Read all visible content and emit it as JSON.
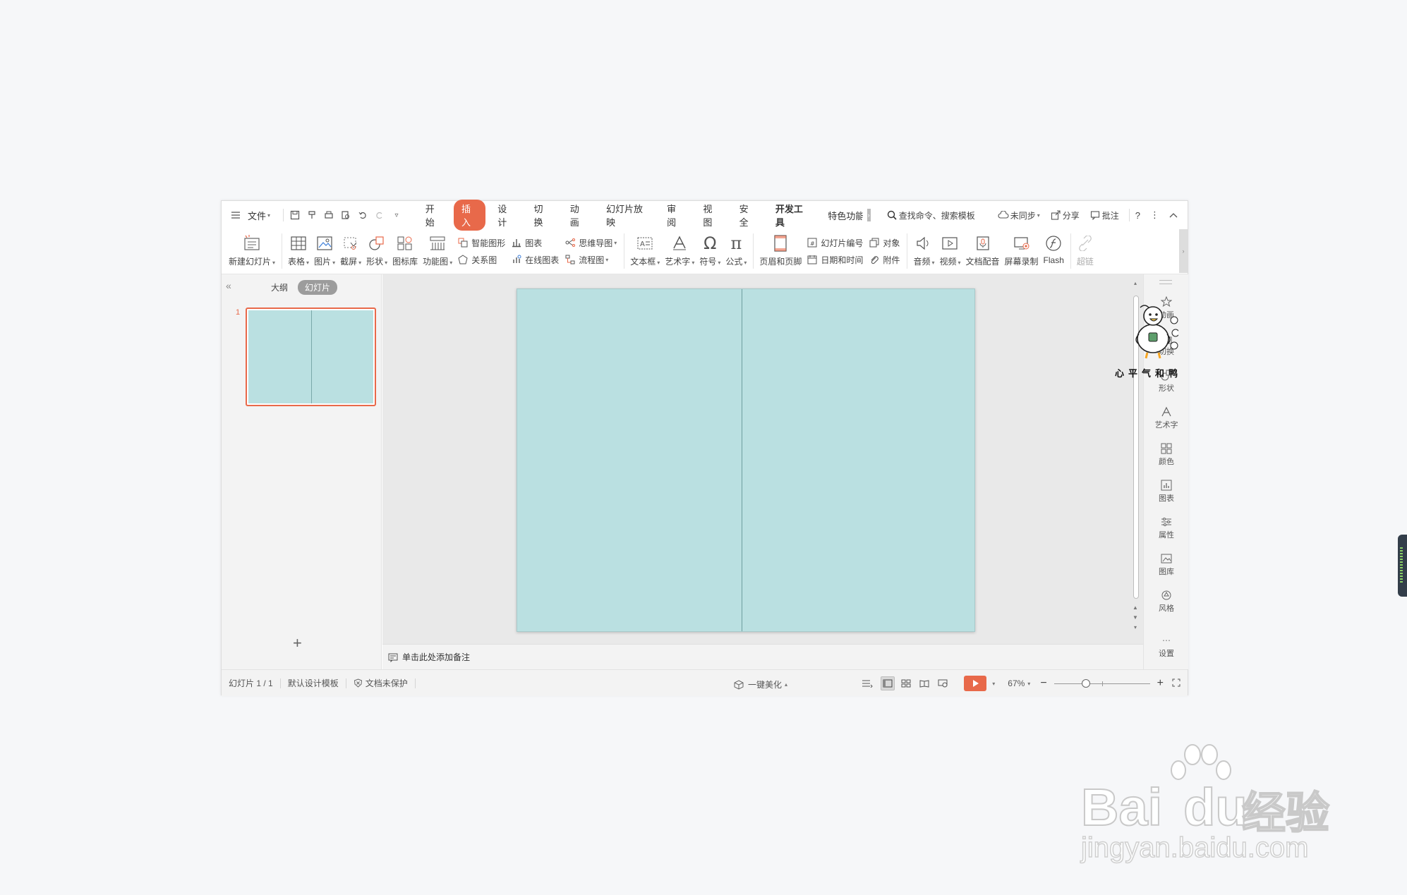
{
  "menubar": {
    "file_label": "文件",
    "tabs": [
      {
        "label": "开始",
        "active": false
      },
      {
        "label": "插入",
        "active": true
      },
      {
        "label": "设计",
        "active": false
      },
      {
        "label": "切换",
        "active": false
      },
      {
        "label": "动画",
        "active": false
      },
      {
        "label": "幻灯片放映",
        "active": false
      },
      {
        "label": "审阅",
        "active": false
      },
      {
        "label": "视图",
        "active": false
      },
      {
        "label": "安全",
        "active": false
      },
      {
        "label": "开发工具",
        "active": false
      },
      {
        "label": "特色功能",
        "active": false
      }
    ],
    "search_label": "查找命令、搜索模板",
    "sync_label": "未同步",
    "share_label": "分享",
    "comment_label": "批注",
    "help_label": "?"
  },
  "ribbon": {
    "new_slide": "新建幻灯片",
    "table": "表格",
    "picture": "图片",
    "screenshot": "截屏",
    "shape": "形状",
    "icon_lib": "图标库",
    "func_chart": "功能图",
    "smart_art": "智能图形",
    "chart": "图表",
    "relation": "关系图",
    "online_chart": "在线图表",
    "mindmap": "思维导图",
    "flowchart": "流程图",
    "textbox": "文本框",
    "wordart": "艺术字",
    "symbol": "符号",
    "formula": "公式",
    "header_footer": "页眉和页脚",
    "slide_number": "幻灯片编号",
    "object": "对象",
    "datetime": "日期和时间",
    "attachment": "附件",
    "audio": "音频",
    "video": "视频",
    "doc_voice": "文档配音",
    "screen_record": "屏幕录制",
    "flash": "Flash",
    "hyperlink": "超链"
  },
  "leftpane": {
    "outline_tab": "大纲",
    "slides_tab": "幻灯片",
    "slide_number": "1"
  },
  "notes": {
    "placeholder": "单击此处添加备注"
  },
  "rightbar": {
    "items": [
      "动画",
      "切换",
      "形状",
      "艺术字",
      "颜色",
      "图表",
      "属性",
      "图库",
      "风格"
    ],
    "settings": "设置"
  },
  "statusbar": {
    "slide_counter": "幻灯片 1 / 1",
    "template": "默认设计模板",
    "protection": "文档未保护",
    "beautify": "一键美化",
    "zoom": "67%",
    "zoom_fraction": 0.33
  },
  "sticker": {
    "caption": "心平气和鸭"
  },
  "watermark": {
    "main": "Bai",
    "du": "du",
    "cn": "经验",
    "url": "jingyan.baidu.com"
  },
  "colors": {
    "accent": "#e8694a",
    "slide_fill": "#bae0e1",
    "canvas": "#e9e9e9"
  }
}
